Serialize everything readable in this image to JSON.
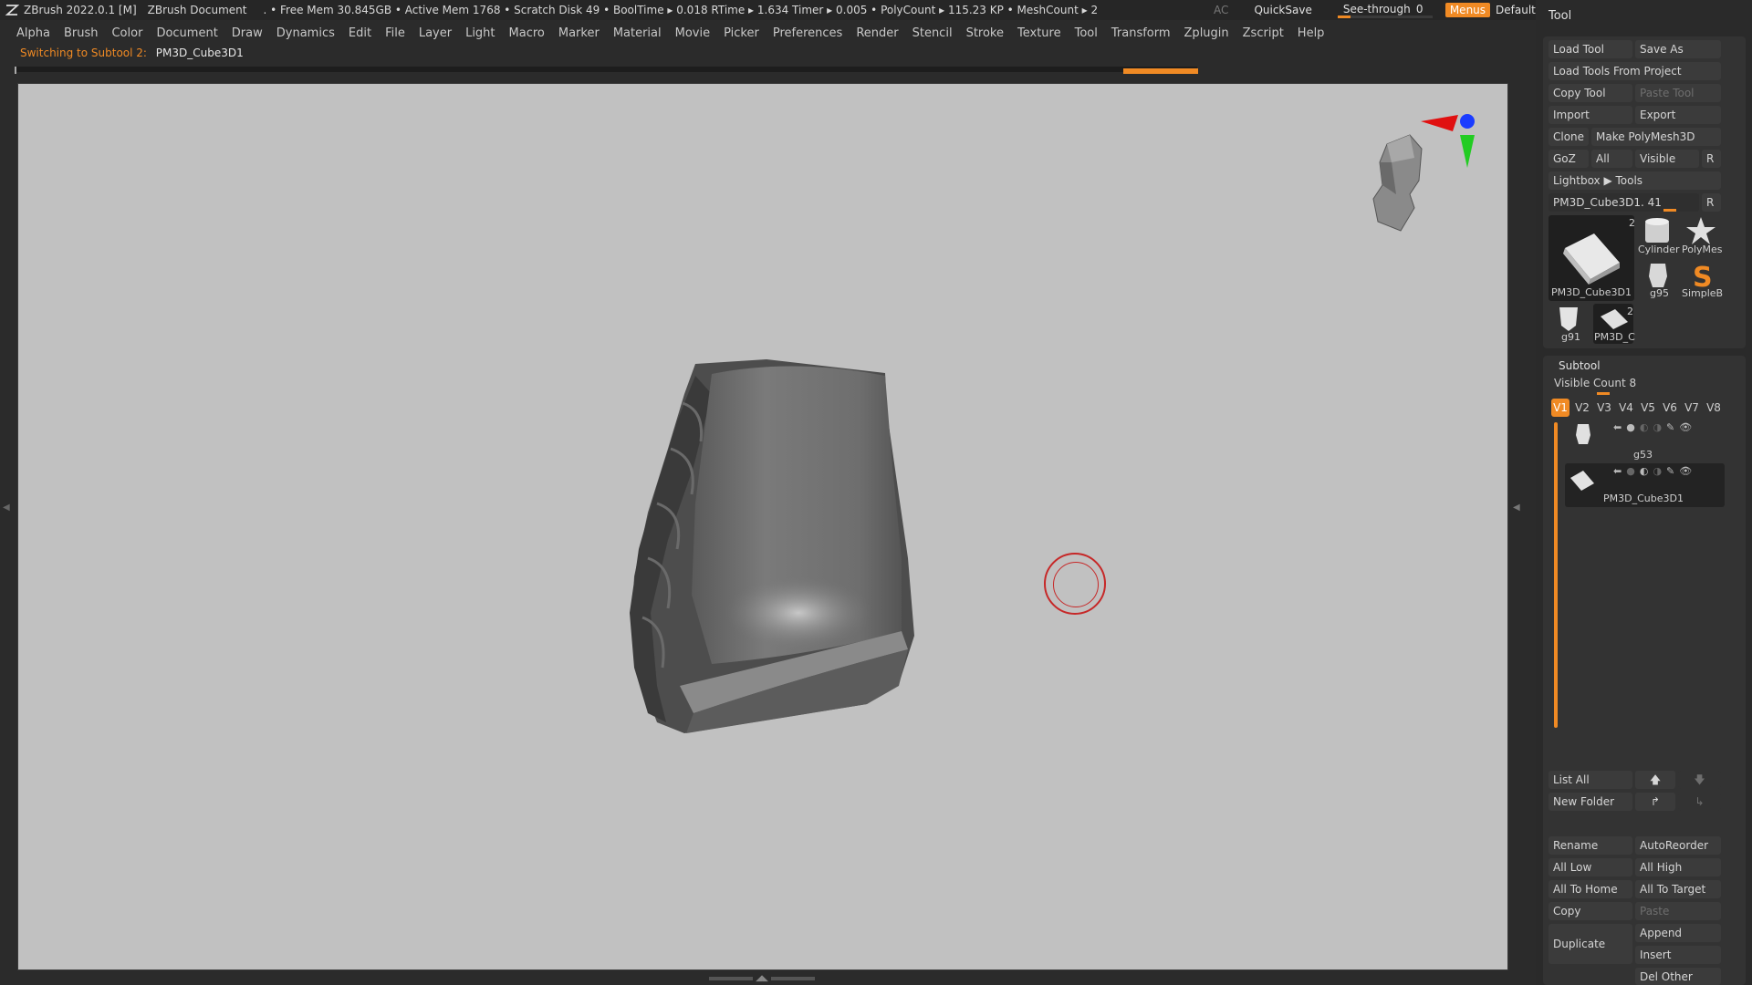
{
  "titlebar": {
    "app": "ZBrush 2022.0.1 [M]",
    "document": "ZBrush Document",
    "stats": ". • Free Mem 30.845GB • Active Mem 1768 • Scratch Disk 49 •  BoolTime ▸ 0.018 RTime ▸ 1.634 Timer ▸ 0.005 • PolyCount ▸ 115.23 KP  • MeshCount ▸ 2",
    "ac": "AC",
    "quicksave": "QuickSave",
    "seethrough_label": "See-through",
    "seethrough_value": "0",
    "menus": "Menus",
    "script": "DefaultZScript"
  },
  "menubar": [
    "Alpha",
    "Brush",
    "Color",
    "Document",
    "Draw",
    "Dynamics",
    "Edit",
    "File",
    "Layer",
    "Light",
    "Macro",
    "Marker",
    "Material",
    "Movie",
    "Picker",
    "Preferences",
    "Render",
    "Stencil",
    "Stroke",
    "Texture",
    "Tool",
    "Transform",
    "Zplugin",
    "Zscript",
    "Help"
  ],
  "notice": {
    "action": "Switching to Subtool 2:",
    "subtool": "PM3D_Cube3D1"
  },
  "tool_panel": {
    "title": "Tool",
    "load_tool": "Load Tool",
    "save_as": "Save As",
    "load_from_project": "Load Tools From Project",
    "copy_tool": "Copy Tool",
    "paste_tool": "Paste Tool",
    "import": "Import",
    "export": "Export",
    "clone": "Clone",
    "make_polymesh": "Make PolyMesh3D",
    "goz": "GoZ",
    "all": "All",
    "visible": "Visible",
    "r": "R",
    "lightbox_tools": "Lightbox ▶ Tools",
    "current_tool": "PM3D_Cube3D1. 41",
    "current_tool_r": "R",
    "thumbs": {
      "main_label": "PM3D_Cube3D1",
      "main_count": "2",
      "cylinder": "Cylinder",
      "polymesh": "PolyMes",
      "g95": "g95",
      "simpleb": "SimpleB",
      "g91": "g91",
      "pm3d_small": "PM3D_C",
      "pm3d_small_count": "2"
    }
  },
  "subtool": {
    "title": "Subtool",
    "visible_count": "Visible Count 8",
    "tabs": [
      "V1",
      "V2",
      "V3",
      "V4",
      "V5",
      "V6",
      "V7",
      "V8"
    ],
    "items": [
      {
        "name": "g53"
      },
      {
        "name": "PM3D_Cube3D1"
      }
    ],
    "list_all": "List All",
    "new_folder": "New Folder",
    "rename": "Rename",
    "autoreorder": "AutoReorder",
    "all_low": "All Low",
    "all_high": "All High",
    "all_to_home": "All To Home",
    "all_to_target": "All To Target",
    "copy": "Copy",
    "paste": "Paste",
    "duplicate": "Duplicate",
    "append": "Append",
    "insert": "Insert",
    "del_other": "Del Other"
  },
  "colors": {
    "accent": "#f08a24",
    "viewport": "#c1c1c1",
    "brush_ring": "#c62828"
  }
}
